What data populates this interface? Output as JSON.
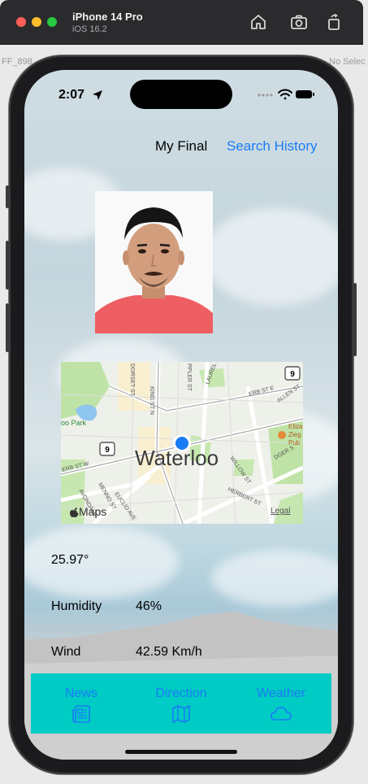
{
  "simulator": {
    "device": "iPhone 14 Pro",
    "os": "iOS 16.2"
  },
  "background_fragments": {
    "left_code": "FF_898",
    "right_label": "No Selec"
  },
  "status_bar": {
    "time": "2:07"
  },
  "nav": {
    "title": "My Final",
    "history_link": "Search History"
  },
  "map": {
    "city": "Waterloo",
    "maps_brand": "Maps",
    "legal": "Legal",
    "streets": [
      "KING ST N",
      "DORSET ST",
      "LAUREL ST",
      "ERB ST E",
      "ALLEN ST",
      "ERB ST W",
      "EUCLID AVE",
      "MENNO ST",
      "AVONDALE",
      "WILLOW ST",
      "HERBERT ST",
      "PPLER ST",
      "HOLLIDGER ST"
    ],
    "route_badges": [
      "9",
      "9"
    ],
    "poi": "Eliza Zieg Pub",
    "park": "oo Park"
  },
  "weather": {
    "temperature": "25.97°",
    "humidity_label": "Humidity",
    "humidity_value": "46%",
    "wind_label": "Wind",
    "wind_value": "42.59 Km/h"
  },
  "tabs": [
    {
      "label": "News",
      "icon": "newspaper-icon"
    },
    {
      "label": "Direction",
      "icon": "map-icon"
    },
    {
      "label": "Weather",
      "icon": "cloud-icon"
    }
  ],
  "colors": {
    "accent": "#1a7cf5",
    "tabbar": "#00cbc4"
  }
}
